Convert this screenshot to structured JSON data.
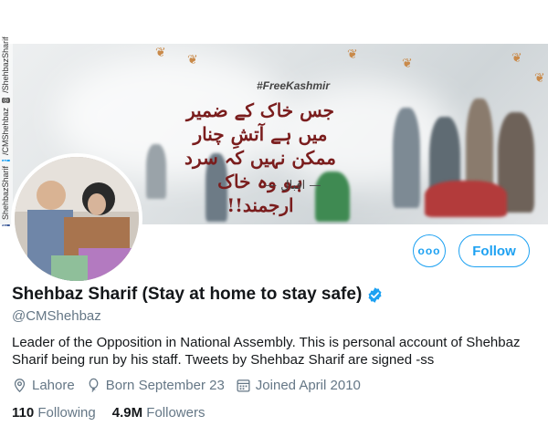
{
  "banner": {
    "hashtag": "#FreeKashmir",
    "poem_lines": [
      "جس خاک کے ضمیر میں ہے آتشِ چنار",
      "ممکن نہیں کہ سرد ہو وہ خاک ارجمند!!"
    ],
    "poem_signature": "— اقبال —",
    "side_text": [
      "ShehbazSharif",
      "/CMShehbaz",
      "/ShehbazSharif"
    ]
  },
  "profile": {
    "name": "Shehbaz Sharif (Stay at home to stay safe)",
    "handle": "@CMShehbaz",
    "bio": "Leader of the Opposition in National Assembly. This is personal account of Shehbaz Sharif being run by his staff. Tweets by Shehbaz Sharif are signed -ss",
    "location": "Lahore",
    "birthday": "Born September 23",
    "joined": "Joined April 2010",
    "following_count": "110",
    "following_label": "Following",
    "followers_count": "4.9M",
    "followers_label": "Followers"
  },
  "actions": {
    "more_label": "ooo",
    "follow_label": "Follow"
  },
  "colors": {
    "accent": "#1da1f2",
    "secondary_text": "#657786",
    "primary_text": "#14171a"
  },
  "icons": [
    "location-icon",
    "balloon-icon",
    "calendar-icon",
    "verified-badge-icon",
    "more-icon"
  ]
}
